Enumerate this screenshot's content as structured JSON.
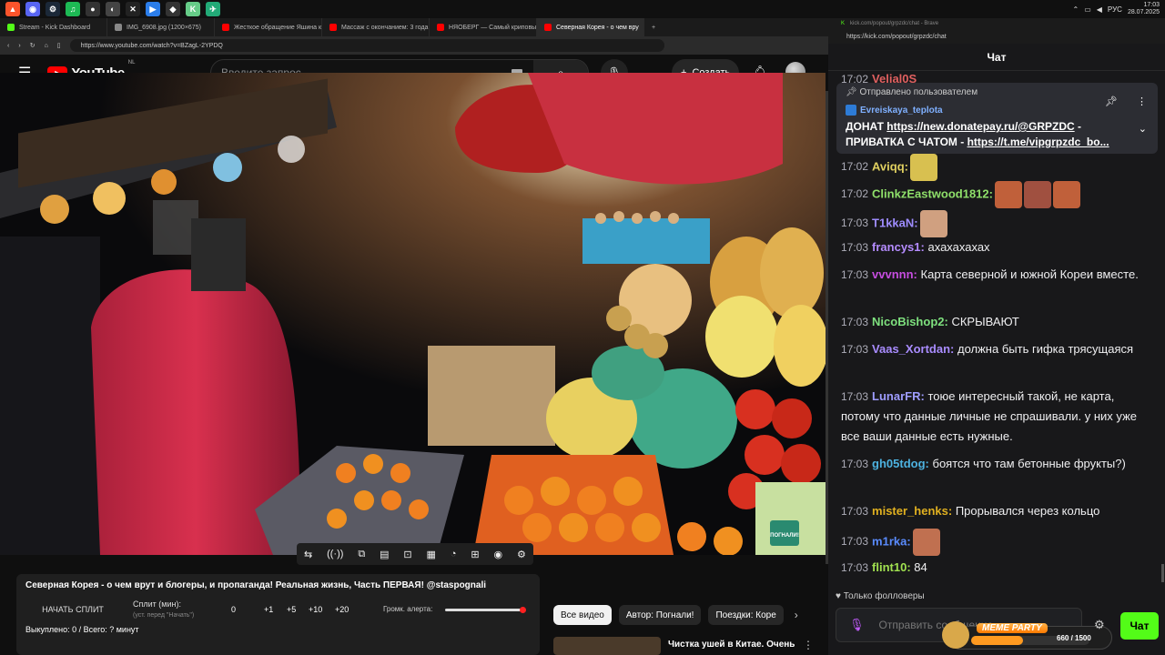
{
  "taskbar": {
    "lang": "РУС",
    "time": "17:03",
    "date": "28.07.2025"
  },
  "tabs": [
    {
      "label": "Stream - Kick Dashboard",
      "color": "#53fc18"
    },
    {
      "label": "IMG_6908.jpg (1200×675)",
      "color": "#888888"
    },
    {
      "label": "Жесткое обращение Яшина к Z-ми",
      "color": "#ff0000"
    },
    {
      "label": "Массаж с окончанием: 3 года не п",
      "color": "#ff0000"
    },
    {
      "label": "НЯОБЕРГ — Самый криповый бле",
      "color": "#ff0000"
    },
    {
      "label": "Северная Корея - о чем вру",
      "color": "#ff0000",
      "active": true
    }
  ],
  "browser": {
    "url": "https://www.youtube.com/watch?v=BZagL-2YPDQ",
    "new_tab": "+"
  },
  "youtube": {
    "logo_text": "YouTube",
    "region": "NL",
    "search_placeholder": "Введите запрос",
    "create_label": "Создать"
  },
  "controls": [
    "⇆",
    "((·))",
    "⧉",
    "▤",
    "⊡",
    "▦",
    "◔",
    "⊞",
    "◉",
    "⚙"
  ],
  "panel": {
    "title": "Северная Корея - о чем врут и блогеры, и пропаганда! Реальная жизнь, Часть ПЕРВАЯ! @staspognali",
    "split_button": "НАЧАТЬ СПЛИТ",
    "split_label": "Сплит (мин):",
    "split_hint": "(уст. перед \"Начать\")",
    "split_value": "0",
    "increments": [
      "+1",
      "+5",
      "+10",
      "+20"
    ],
    "volume_label": "Громк. алерта:",
    "volume_fraction": 0.97,
    "bought": "Выкуплено: 0 / Всего: ? минут"
  },
  "chips": [
    "Все видео",
    "Автор: Погнали!",
    "Поездки: Коре"
  ],
  "recommended": {
    "title": "Чистка ушей в Китае. Очень"
  },
  "video": {
    "watermark": "ПОГНАЛИ!"
  },
  "chatwin": {
    "title": "kick.com/popout/grpzdc/chat - Brave",
    "url": "https://kick.com/popout/grpzdc/chat",
    "header": "Чат"
  },
  "pinned": {
    "head": "Отправлено пользователем",
    "user": "Evreiskaya_teplota",
    "line1_prefix": "ДОНАТ ",
    "line1_link": "https://new.donatepay.ru/@GRPZDC",
    "line1_suffix": " -",
    "line2_prefix": "ПРИВАТКА С ЧАТОМ - ",
    "line2_link": "https://t.me/vipgrpzdc_bo..."
  },
  "messages": [
    {
      "time": "17:02",
      "user": "Aviqq",
      "color": "#e0d060",
      "text": "",
      "emotes": [
        "#d8c050"
      ]
    },
    {
      "time": "17:02",
      "user": "ClinkzEastwood1812",
      "color": "#8fe06a",
      "text": "",
      "emotes": [
        "#c0603a",
        "#a05040",
        "#c0603a"
      ]
    },
    {
      "time": "17:03",
      "user": "T1kkaN",
      "color": "#9e8cff",
      "text": "",
      "emotes": [
        "#d0a080"
      ]
    },
    {
      "time": "17:03",
      "user": "francys1",
      "color": "#b58cff",
      "text": "ахахахахах",
      "emotes": []
    },
    {
      "time": "17:03",
      "user": "vvvnnn",
      "color": "#c64de0",
      "text": "Карта северной и южной Кореи вместе.",
      "emotes": []
    },
    {
      "time": "17:03",
      "user": "NicoBishop2",
      "color": "#7ee07e",
      "text": "СКРЫВАЮТ",
      "emotes": []
    },
    {
      "time": "17:03",
      "user": "Vaas_Xortdan",
      "color": "#a98cff",
      "text": "должна быть гифка трясущаяся",
      "emotes": []
    },
    {
      "time": "17:03",
      "user": "LunarFR",
      "color": "#9e9cff",
      "text": "тоюе интересный такой, не карта, потому что данные личные не спрашивали. у них уже все ваши данные есть нужные.",
      "emotes": []
    },
    {
      "time": "17:03",
      "user": "gh05tdog",
      "color": "#4db2e0",
      "text": "боятся что там бетонные фрукты?)",
      "emotes": []
    },
    {
      "time": "17:03",
      "user": "mister_henks",
      "color": "#e0b020",
      "text": "Прорывался через кольцо",
      "emotes": []
    },
    {
      "time": "17:03",
      "user": "m1rka",
      "color": "#5a8cff",
      "text": "",
      "emotes": [
        "#c07050"
      ]
    },
    {
      "time": "17:03",
      "user": "flint10",
      "color": "#a0e050",
      "text": "84",
      "emotes": []
    }
  ],
  "top_partial": {
    "time": "17:02",
    "user": "Velial0S",
    "color": "#e06060"
  },
  "chat_footer": {
    "followers_only": "Только фолловеры",
    "input_placeholder": "Отправить сообщение...",
    "send_label": "Чат",
    "meme_label": "MEME PARTY",
    "meme_count": "660 / 1500",
    "meme_fraction": 0.44
  }
}
